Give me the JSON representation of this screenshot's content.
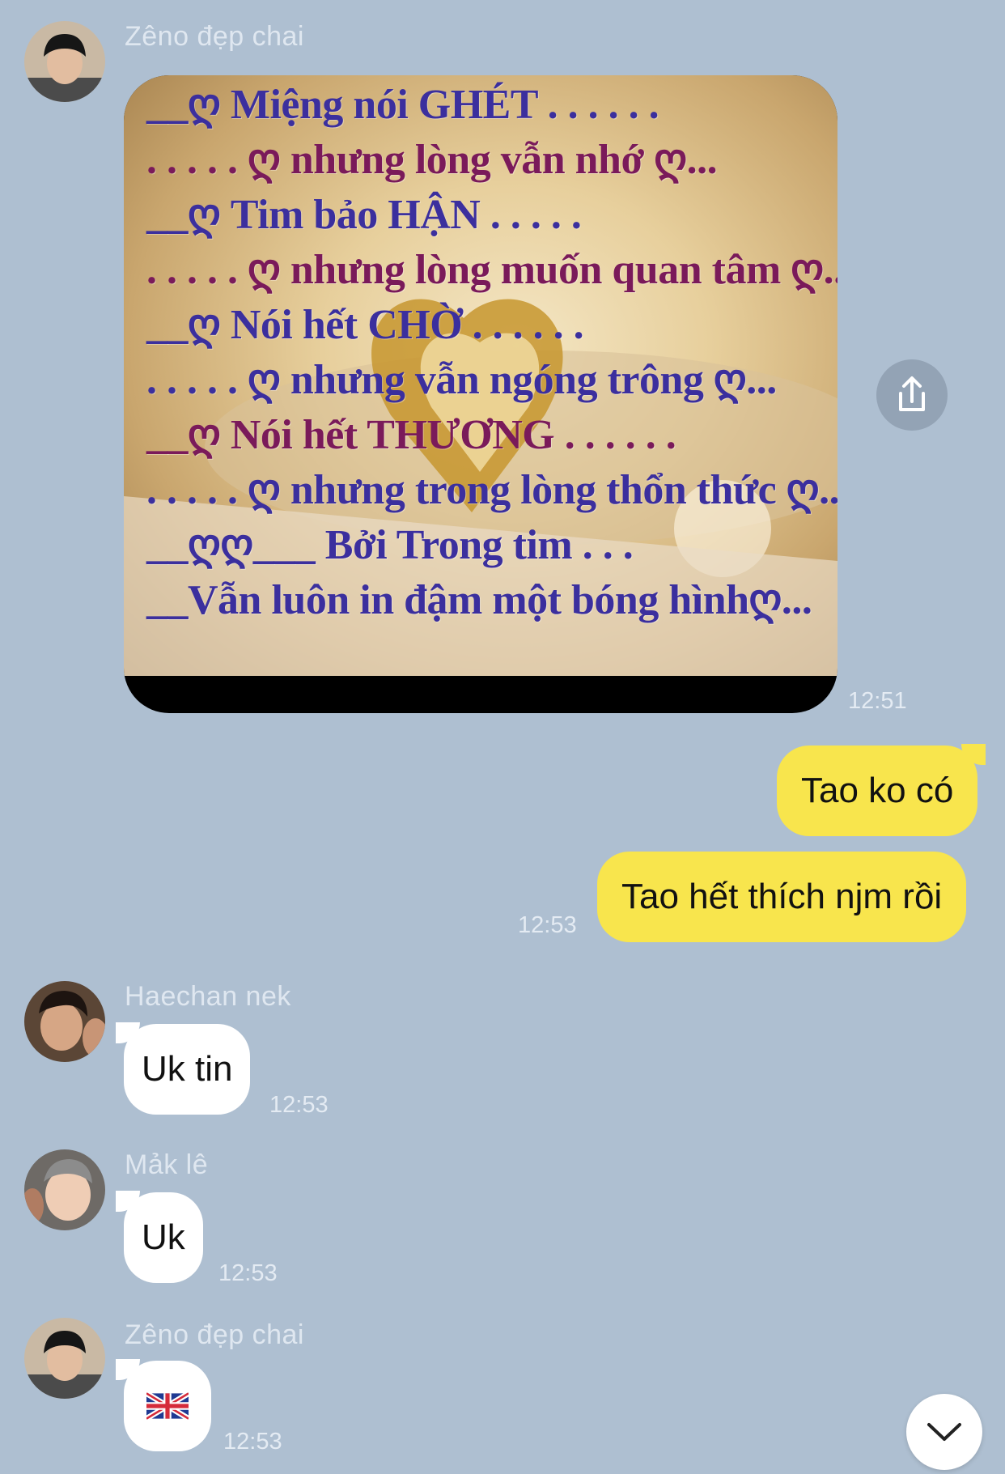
{
  "messages": [
    {
      "sender": "Zêno đẹp chai",
      "type": "image",
      "time": "12:51",
      "image_text": [
        "__ღ Miệng nói GHÉT . . . . . .",
        ". . . . . ღ nhưng lòng vẫn nhớ ღ...",
        "__ღ Tim bảo HẬN . . . . .",
        ". . . . . ღ nhưng lòng muốn quan tâm ღ...",
        "__ღ Nói hết CHỜ . . . . . .",
        ". . . . . ღ nhưng vẫn ngóng trông ღ...",
        "__ღ Nói hết THƯƠNG . . . . . .",
        ". . . . . ღ nhưng trong lòng thổn thức ღ...",
        "__ღღ___ Bởi Trong tim . . .",
        "__Vẫn luôn in đậm một bóng hìnhღ..."
      ]
    },
    {
      "sender": "me",
      "type": "text",
      "text": "Tao ko có"
    },
    {
      "sender": "me",
      "type": "text",
      "text": "Tao hết thích njm rồi",
      "time": "12:53"
    },
    {
      "sender": "Haechan nek",
      "type": "text",
      "text": "Uk tin",
      "time": "12:53"
    },
    {
      "sender": "Mảk lê",
      "type": "text",
      "text": "Uk",
      "time": "12:53"
    },
    {
      "sender": "Zêno đẹp chai",
      "type": "emoji",
      "text": "🇬🇧",
      "time": "12:53"
    }
  ],
  "colors": {
    "background": "#aebfd1",
    "incoming_bubble": "#ffffff",
    "outgoing_bubble": "#f8e54d",
    "name_text": "#dfe7f0",
    "time_text": "#e4ebf3"
  },
  "icons": {
    "share": "share-icon",
    "scroll_down": "chevron-down-icon"
  }
}
